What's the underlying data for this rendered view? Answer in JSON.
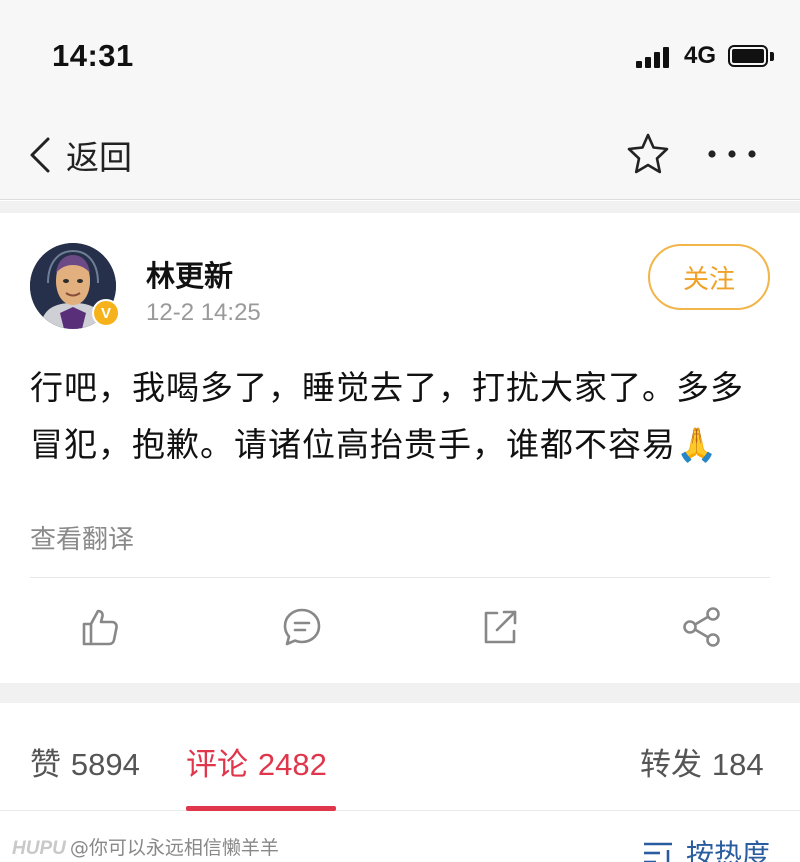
{
  "status_bar": {
    "time": "14:31",
    "network": "4G"
  },
  "nav": {
    "back_label": "返回"
  },
  "post": {
    "author": "林更新",
    "verified_mark": "V",
    "timestamp": "12-2 14:25",
    "follow_label": "关注",
    "text": "行吧，我喝多了，睡觉去了，打扰大家了。多多冒犯，抱歉。请诸位高抬贵手，谁都不容易🙏",
    "translate_label": "查看翻译"
  },
  "stats": {
    "likes_label": "赞",
    "likes_count": "5894",
    "comments_label": "评论",
    "comments_count": "2482",
    "reposts_label": "转发",
    "reposts_count": "184",
    "active_tab": "comments"
  },
  "footer": {
    "watermark_brand": "HUPU",
    "watermark_user": "@你可以永远相信懒羊羊",
    "sort_label": "按热度"
  },
  "colors": {
    "accent": "#e0364c",
    "follow": "#f0a126",
    "link": "#2a5d9f",
    "badge": "#f6b21b"
  }
}
